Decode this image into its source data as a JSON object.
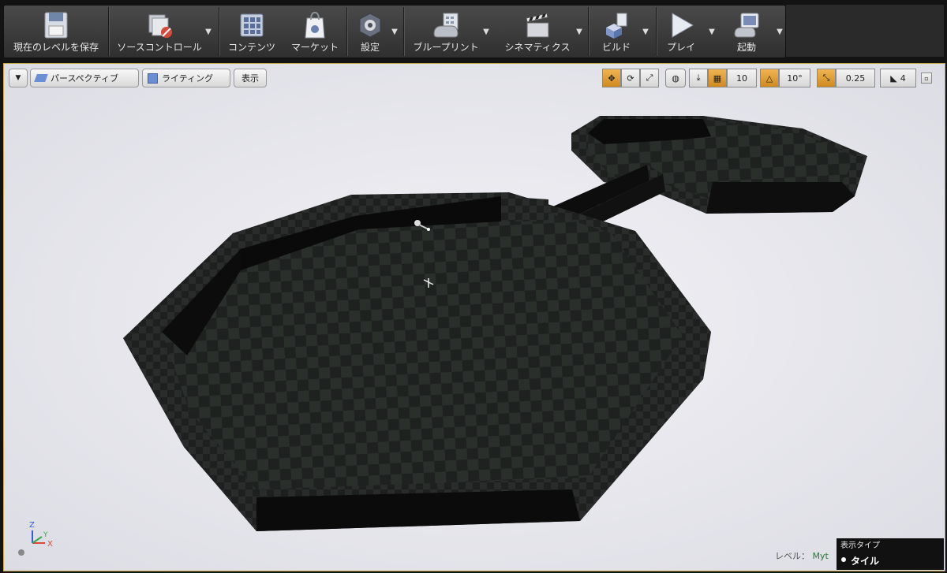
{
  "toolbar": {
    "buttons": [
      {
        "label": "現在のレベルを保存",
        "icon": "save-icon"
      },
      {
        "label": "ソースコントロール",
        "icon": "source-control-icon"
      },
      {
        "label": "コンテンツ",
        "icon": "content-icon"
      },
      {
        "label": "マーケット",
        "icon": "marketplace-icon"
      },
      {
        "label": "設定",
        "icon": "settings-icon"
      },
      {
        "label": "ブループリント",
        "icon": "blueprint-icon"
      },
      {
        "label": "シネマティクス",
        "icon": "cinematics-icon"
      },
      {
        "label": "ビルド",
        "icon": "build-icon"
      },
      {
        "label": "プレイ",
        "icon": "play-icon"
      },
      {
        "label": "起動",
        "icon": "launch-icon"
      }
    ]
  },
  "viewport": {
    "view_mode": "パースペクティブ",
    "lighting": "ライティング",
    "show": "表示",
    "grid_snap": "10",
    "rotation_snap": "10°",
    "scale_snap": "0.25",
    "camera_speed": "4",
    "level_label": "レベル：",
    "level_name": "Myt"
  },
  "display_type_panel": {
    "title": "表示タイプ",
    "option": "タイル"
  },
  "colors": {
    "accent": "#e0a030",
    "toolbar_bg": "#3a3a3a",
    "viewport_bg": "#e8e8ee",
    "floor_dark": "#1c1e1d",
    "floor_light": "#2c302e"
  }
}
